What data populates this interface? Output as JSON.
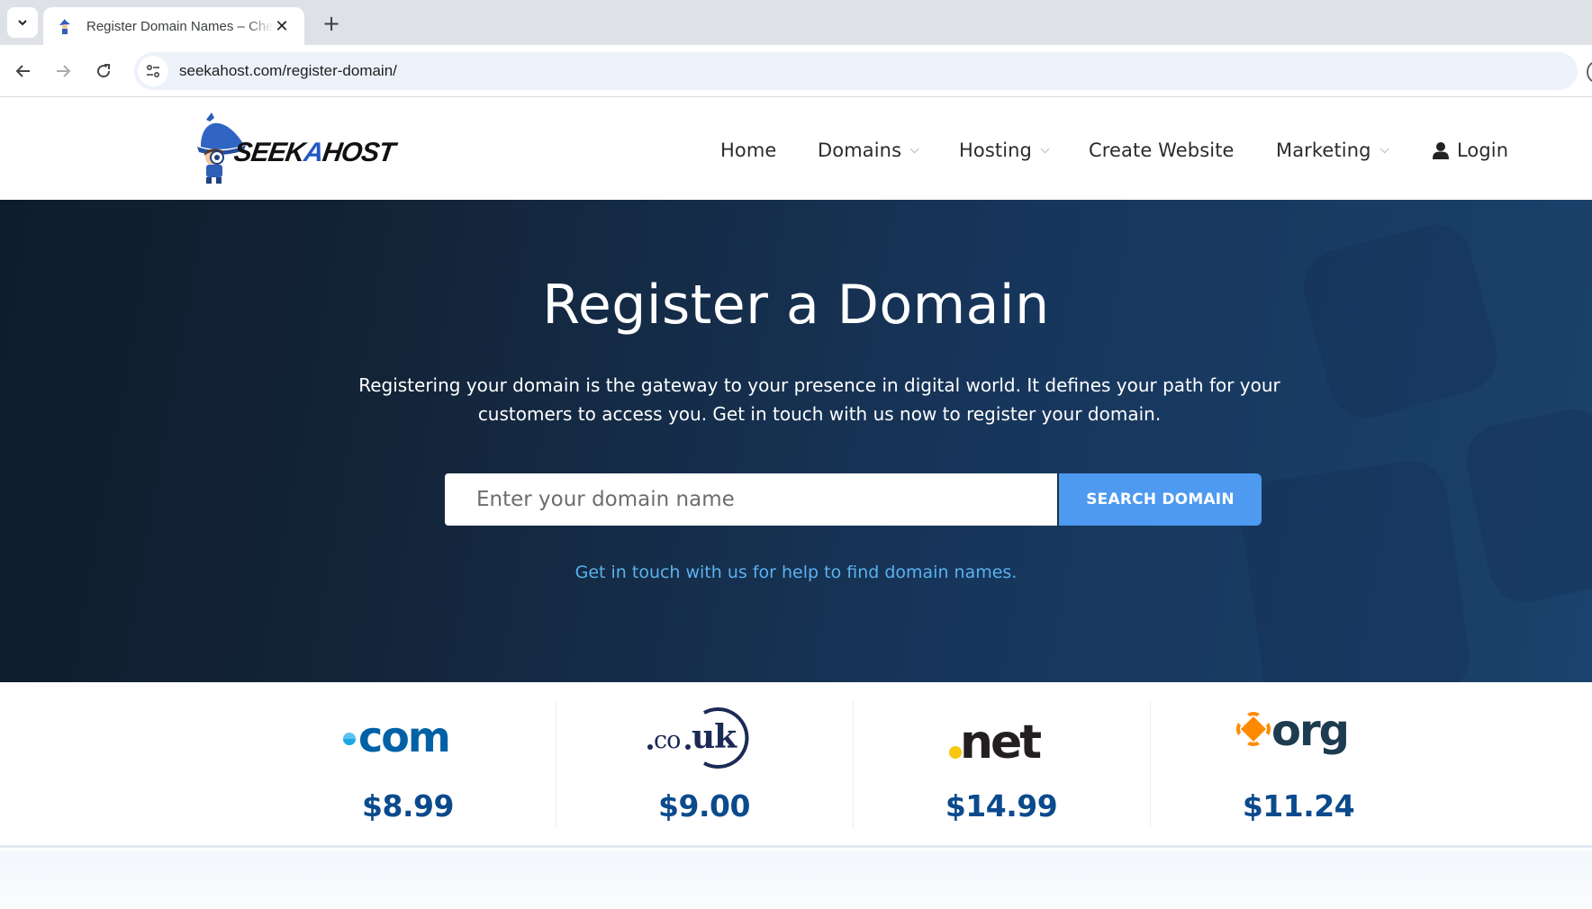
{
  "browser": {
    "tab": {
      "title": "Register Domain Names – Cheap Domain Registration",
      "favicon": "seekahost-wizard-icon",
      "close_glyph": "✕"
    },
    "new_tab_glyph": "+",
    "url": "seekahost.com/register-domain/"
  },
  "header": {
    "logo_text_1": "SEEK",
    "logo_text_2": "A",
    "logo_text_3": "HOST",
    "nav": [
      {
        "label": "Home",
        "dropdown": false
      },
      {
        "label": "Domains",
        "dropdown": true
      },
      {
        "label": "Hosting",
        "dropdown": true
      },
      {
        "label": "Create Website",
        "dropdown": false
      },
      {
        "label": "Marketing",
        "dropdown": true
      }
    ],
    "login_label": "Login"
  },
  "hero": {
    "title": "Register a Domain",
    "description": "Registering your domain is the gateway to your presence in digital world. It defines your path for your customers to access you. Get in touch with us now to register your domain.",
    "search": {
      "value": "",
      "placeholder": "Enter your domain name",
      "button_label": "SEARCH DOMAIN"
    },
    "help_link": "Get in touch with us for help to find domain names."
  },
  "tlds": [
    {
      "extension": ".com",
      "price": "$8.99"
    },
    {
      "extension": ".co.uk",
      "price": "$9.00"
    },
    {
      "extension": ".net",
      "price": "$14.99"
    },
    {
      "extension": ".org",
      "price": "$11.24"
    }
  ],
  "colors": {
    "hero_dark": "#0f1c2b",
    "hero_blue": "#1a426c",
    "button_blue": "#4d9af0",
    "link_blue": "#59b2ee",
    "price_blue": "#0b4a8c",
    "com_blue": "#0061a6",
    "couk_navy": "#1b2a55",
    "net_yellow": "#f6c80f",
    "org_orange": "#ff8a00",
    "org_navy": "#1d3c50"
  }
}
